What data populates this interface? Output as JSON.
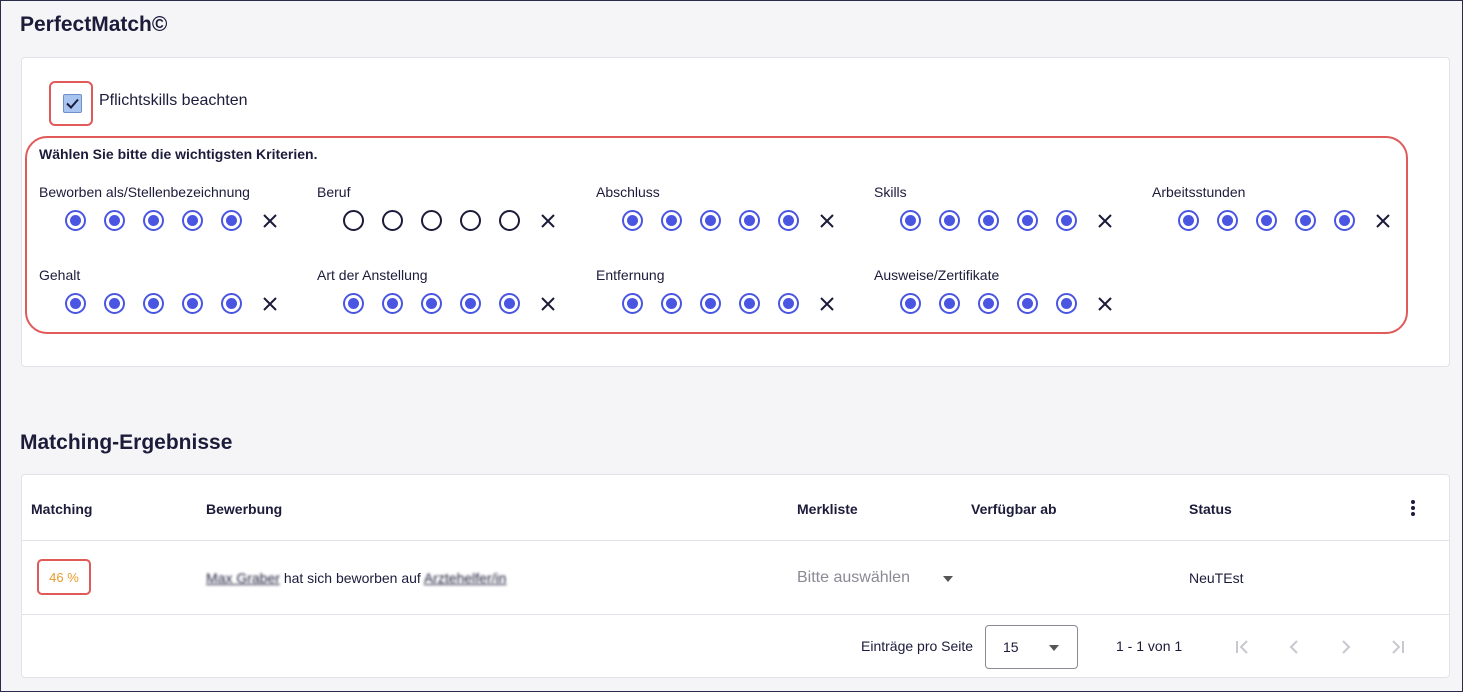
{
  "header": {
    "title": "PerfectMatch©"
  },
  "mandatory_skills": {
    "label": "Pflichtskills beachten",
    "checked": true
  },
  "criteria": {
    "title": "Wählen Sie bitte die wichtigsten Kriterien.",
    "items": [
      {
        "label": "Beworben als/Stellenbezeichnung",
        "level": 5
      },
      {
        "label": "Beruf",
        "level": 0
      },
      {
        "label": "Abschluss",
        "level": 5
      },
      {
        "label": "Skills",
        "level": 5
      },
      {
        "label": "Arbeitsstunden",
        "level": 5
      },
      {
        "label": "Gehalt",
        "level": 5
      },
      {
        "label": "Art der Anstellung",
        "level": 5
      },
      {
        "label": "Entfernung",
        "level": 5
      },
      {
        "label": "Ausweise/Zertifikate",
        "level": 5
      }
    ]
  },
  "results": {
    "title": "Matching-Ergebnisse",
    "columns": [
      "Matching",
      "Bewerbung",
      "Merkliste",
      "Verfügbar ab",
      "Status"
    ],
    "rows": [
      {
        "matching": "46 %",
        "applicant": "Max Graber",
        "applied_text": "hat sich beworben auf",
        "position": "Arztehelfer/in",
        "merkliste_placeholder": "Bitte auswählen",
        "available_from": "",
        "status": "NeuTEst"
      }
    ]
  },
  "pagination": {
    "per_page_label": "Einträge pro Seite",
    "per_page_value": "15",
    "range": "1 - 1 von 1"
  },
  "colors": {
    "accent": "#4a56e2",
    "highlight": "#e05a5a",
    "matching": "#e89a2e"
  }
}
